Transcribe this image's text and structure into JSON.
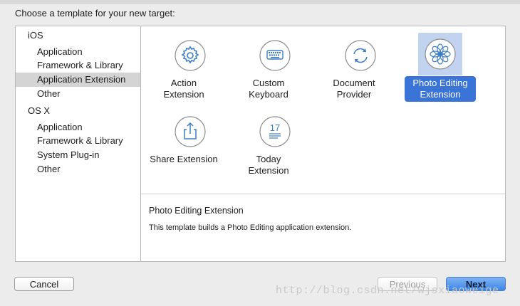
{
  "header": {
    "title": "Choose a template for your new target:"
  },
  "sidebar": {
    "groups": [
      {
        "label": "iOS",
        "items": [
          "Application",
          "Framework & Library",
          "Application Extension",
          "Other"
        ]
      },
      {
        "label": "OS X",
        "items": [
          "Application",
          "Framework & Library",
          "System Plug-in",
          "Other"
        ]
      }
    ],
    "selected": "Application Extension"
  },
  "templates": [
    {
      "line1": "Action",
      "line2": "Extension",
      "icon": "gear-icon"
    },
    {
      "line1": "Custom",
      "line2": "Keyboard",
      "icon": "keyboard-icon"
    },
    {
      "line1": "Document",
      "line2": "Provider",
      "icon": "refresh-icon"
    },
    {
      "line1": "Photo Editing",
      "line2": "Extension",
      "icon": "flower-icon",
      "selected": true
    },
    {
      "line1": "Share Extension",
      "line2": "",
      "icon": "share-icon"
    },
    {
      "line1": "Today",
      "line2": "Extension",
      "icon": "today-icon"
    }
  ],
  "today_icon_text": "17",
  "description": {
    "title": "Photo Editing Extension",
    "text": "This template builds a Photo Editing application extension."
  },
  "buttons": {
    "cancel": "Cancel",
    "previous": "Previous",
    "next": "Next"
  },
  "watermark": "http://blog.csdn.net/wjsxiaoweige",
  "colors": {
    "accent": "#3a74d7",
    "selection_bg": "#c2d3f0",
    "sidebar_selected": "#d4d4d4"
  }
}
